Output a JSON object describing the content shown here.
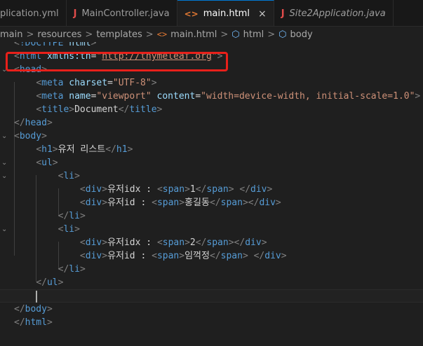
{
  "tabs": [
    {
      "label": "plication.yml",
      "icon": "",
      "active": false,
      "italic": false
    },
    {
      "label": "MainController.java",
      "icon": "J",
      "active": false,
      "italic": false
    },
    {
      "label": "main.html",
      "icon": "<>",
      "active": true,
      "italic": false,
      "close": "×"
    },
    {
      "label": "Site2Application.java",
      "icon": "J",
      "active": false,
      "italic": true
    }
  ],
  "breadcrumb": {
    "items": [
      "main",
      "resources",
      "templates",
      "main.html",
      "html",
      "body"
    ],
    "separator": ">",
    "html_icon": "<>",
    "element_icon": "⬡"
  },
  "code_lines": [
    [
      [
        "pn",
        "<"
      ],
      [
        "tg",
        "!DOCTYPE"
      ],
      [
        "tx",
        " "
      ],
      [
        "at",
        "html"
      ],
      [
        "pn",
        ">"
      ]
    ],
    [
      [
        "pn",
        "<"
      ],
      [
        "tg",
        "html"
      ],
      [
        "tx",
        " "
      ],
      [
        "at",
        "xmlns:th"
      ],
      [
        "tx",
        "="
      ],
      [
        "st",
        "\""
      ],
      [
        "lk",
        "http://thymeleaf.org"
      ],
      [
        "st",
        "\""
      ],
      [
        "pn",
        ">"
      ]
    ],
    [
      [
        "pn",
        "<"
      ],
      [
        "tg",
        "head"
      ],
      [
        "pn",
        ">"
      ]
    ],
    [
      [
        "tx",
        "    "
      ],
      [
        "pn",
        "<"
      ],
      [
        "tg",
        "meta"
      ],
      [
        "tx",
        " "
      ],
      [
        "at",
        "charset"
      ],
      [
        "tx",
        "="
      ],
      [
        "st",
        "\"UTF-8\""
      ],
      [
        "pn",
        ">"
      ]
    ],
    [
      [
        "tx",
        "    "
      ],
      [
        "pn",
        "<"
      ],
      [
        "tg",
        "meta"
      ],
      [
        "tx",
        " "
      ],
      [
        "at",
        "name"
      ],
      [
        "tx",
        "="
      ],
      [
        "st",
        "\"viewport\""
      ],
      [
        "tx",
        " "
      ],
      [
        "at",
        "content"
      ],
      [
        "tx",
        "="
      ],
      [
        "st",
        "\"width=device-width, initial-scale=1.0\""
      ],
      [
        "pn",
        ">"
      ]
    ],
    [
      [
        "tx",
        "    "
      ],
      [
        "pn",
        "<"
      ],
      [
        "tg",
        "title"
      ],
      [
        "pn",
        ">"
      ],
      [
        "tx",
        "Document"
      ],
      [
        "pn",
        "</"
      ],
      [
        "tg",
        "title"
      ],
      [
        "pn",
        ">"
      ]
    ],
    [
      [
        "pn",
        "</"
      ],
      [
        "tg",
        "head"
      ],
      [
        "pn",
        ">"
      ]
    ],
    [
      [
        "pn",
        "<"
      ],
      [
        "tg",
        "body"
      ],
      [
        "pn",
        ">"
      ]
    ],
    [
      [
        "tx",
        "    "
      ],
      [
        "pn",
        "<"
      ],
      [
        "tg",
        "h1"
      ],
      [
        "pn",
        ">"
      ],
      [
        "tx",
        "유저 리스트"
      ],
      [
        "pn",
        "</"
      ],
      [
        "tg",
        "h1"
      ],
      [
        "pn",
        ">"
      ]
    ],
    [
      [
        "tx",
        "    "
      ],
      [
        "pn",
        "<"
      ],
      [
        "tg",
        "ul"
      ],
      [
        "pn",
        ">"
      ]
    ],
    [
      [
        "tx",
        "        "
      ],
      [
        "pn",
        "<"
      ],
      [
        "tg",
        "li"
      ],
      [
        "pn",
        ">"
      ]
    ],
    [
      [
        "tx",
        "            "
      ],
      [
        "pn",
        "<"
      ],
      [
        "tg",
        "div"
      ],
      [
        "pn",
        ">"
      ],
      [
        "tx",
        "유저idx : "
      ],
      [
        "pn",
        "<"
      ],
      [
        "tg",
        "span"
      ],
      [
        "pn",
        ">"
      ],
      [
        "tx",
        "1"
      ],
      [
        "pn",
        "</"
      ],
      [
        "tg",
        "span"
      ],
      [
        "pn",
        ">"
      ],
      [
        "tx",
        " "
      ],
      [
        "pn",
        "</"
      ],
      [
        "tg",
        "div"
      ],
      [
        "pn",
        ">"
      ]
    ],
    [
      [
        "tx",
        "            "
      ],
      [
        "pn",
        "<"
      ],
      [
        "tg",
        "div"
      ],
      [
        "pn",
        ">"
      ],
      [
        "tx",
        "유저id : "
      ],
      [
        "pn",
        "<"
      ],
      [
        "tg",
        "span"
      ],
      [
        "pn",
        ">"
      ],
      [
        "tx",
        "홍길동"
      ],
      [
        "pn",
        "</"
      ],
      [
        "tg",
        "span"
      ],
      [
        "pn",
        ">"
      ],
      [
        "pn",
        "</"
      ],
      [
        "tg",
        "div"
      ],
      [
        "pn",
        ">"
      ]
    ],
    [
      [
        "tx",
        "        "
      ],
      [
        "pn",
        "</"
      ],
      [
        "tg",
        "li"
      ],
      [
        "pn",
        ">"
      ]
    ],
    [
      [
        "tx",
        "        "
      ],
      [
        "pn",
        "<"
      ],
      [
        "tg",
        "li"
      ],
      [
        "pn",
        ">"
      ]
    ],
    [
      [
        "tx",
        "            "
      ],
      [
        "pn",
        "<"
      ],
      [
        "tg",
        "div"
      ],
      [
        "pn",
        ">"
      ],
      [
        "tx",
        "유저idx : "
      ],
      [
        "pn",
        "<"
      ],
      [
        "tg",
        "span"
      ],
      [
        "pn",
        ">"
      ],
      [
        "tx",
        "2"
      ],
      [
        "pn",
        "</"
      ],
      [
        "tg",
        "span"
      ],
      [
        "pn",
        ">"
      ],
      [
        "pn",
        "</"
      ],
      [
        "tg",
        "div"
      ],
      [
        "pn",
        ">"
      ]
    ],
    [
      [
        "tx",
        "            "
      ],
      [
        "pn",
        "<"
      ],
      [
        "tg",
        "div"
      ],
      [
        "pn",
        ">"
      ],
      [
        "tx",
        "유저id : "
      ],
      [
        "pn",
        "<"
      ],
      [
        "tg",
        "span"
      ],
      [
        "pn",
        ">"
      ],
      [
        "tx",
        "임꺽정"
      ],
      [
        "pn",
        "</"
      ],
      [
        "tg",
        "span"
      ],
      [
        "pn",
        ">"
      ],
      [
        "tx",
        " "
      ],
      [
        "pn",
        "</"
      ],
      [
        "tg",
        "div"
      ],
      [
        "pn",
        ">"
      ]
    ],
    [
      [
        "tx",
        "        "
      ],
      [
        "pn",
        "</"
      ],
      [
        "tg",
        "li"
      ],
      [
        "pn",
        ">"
      ]
    ],
    [
      [
        "tx",
        "    "
      ],
      [
        "pn",
        "</"
      ],
      [
        "tg",
        "ul"
      ],
      [
        "pn",
        ">"
      ]
    ],
    [
      [
        "tx",
        ""
      ]
    ],
    [
      [
        "pn",
        "</"
      ],
      [
        "tg",
        "body"
      ],
      [
        "pn",
        ">"
      ]
    ],
    [
      [
        "pn",
        "</"
      ],
      [
        "tg",
        "html"
      ],
      [
        "pn",
        ">"
      ]
    ]
  ],
  "colors": {
    "tag": "#569cd6",
    "attribute": "#9cdcfe",
    "string": "#ce9178",
    "text": "#d4d4d4",
    "highlight_box": "#e8201a",
    "java_icon": "#e24c4b",
    "html_icon": "#e37933"
  }
}
